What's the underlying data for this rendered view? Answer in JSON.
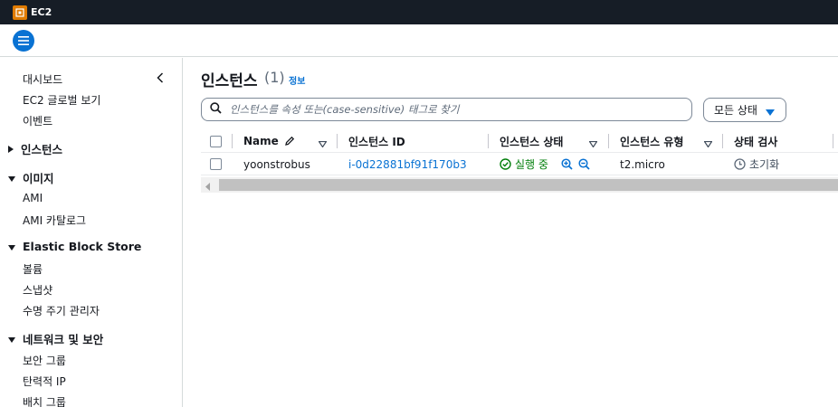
{
  "header": {
    "service_name": "EC2"
  },
  "colors": {
    "accent": "#0972d3",
    "topbar": "#161d26",
    "success": "#037f0c",
    "service_icon": "#e07b00"
  },
  "sidebar": {
    "items": [
      {
        "type": "link",
        "label": "대시보드"
      },
      {
        "type": "link",
        "label": "EC2 글로벌 보기"
      },
      {
        "type": "link",
        "label": "이벤트"
      },
      {
        "type": "section",
        "label": "인스턴스",
        "expanded": false
      },
      {
        "type": "section",
        "label": "이미지",
        "expanded": true
      },
      {
        "type": "link",
        "label": "AMI"
      },
      {
        "type": "link",
        "label": "AMI 카탈로그"
      },
      {
        "type": "section",
        "label": "Elastic Block Store",
        "expanded": true
      },
      {
        "type": "link",
        "label": "볼륨"
      },
      {
        "type": "link",
        "label": "스냅샷"
      },
      {
        "type": "link",
        "label": "수명 주기 관리자"
      },
      {
        "type": "section",
        "label": "네트워크 및 보안",
        "expanded": true
      },
      {
        "type": "link",
        "label": "보안 그룹"
      },
      {
        "type": "link",
        "label": "탄력적 IP"
      },
      {
        "type": "link",
        "label": "배치 그룹"
      }
    ]
  },
  "main": {
    "title": "인스턴스",
    "count": "(1)",
    "info_label": "정보",
    "search_placeholder": "인스턴스를 속성 또는(case-sensitive) 태그로 찾기",
    "search_value": "",
    "status_filter_label": "모든 상태",
    "table": {
      "columns": [
        "Name",
        "인스턴스 ID",
        "인스턴스 상태",
        "인스턴스 유형",
        "상태 검사"
      ],
      "rows": [
        {
          "name": "yoonstrobus",
          "instance_id": "i-0d22881bf91f170b3",
          "state": "실행 중",
          "type": "t2.micro",
          "status_check": "초기화"
        }
      ]
    }
  }
}
